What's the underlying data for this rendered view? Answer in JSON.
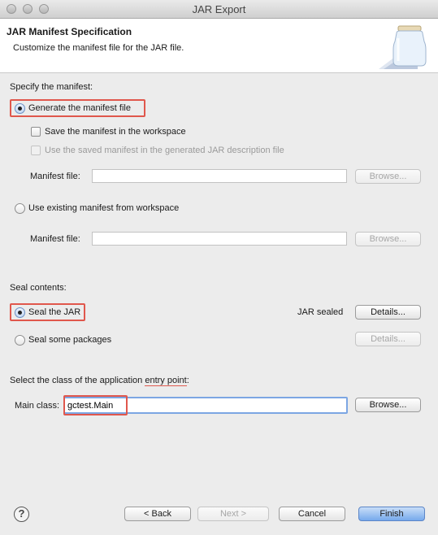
{
  "window": {
    "title": "JAR Export"
  },
  "banner": {
    "title": "JAR Manifest Specification",
    "subtitle": "Customize the manifest file for the JAR file.",
    "icon": "jar-icon"
  },
  "manifest": {
    "section_label": "Specify the manifest:",
    "generate_label": "Generate the manifest file",
    "generate_selected": true,
    "save_in_workspace_label": "Save the manifest in the workspace",
    "save_in_workspace_checked": false,
    "use_saved_label": "Use the saved manifest in the generated JAR description file",
    "use_saved_enabled": false,
    "manifest_file_label_1": "Manifest file:",
    "manifest_file_value_1": "",
    "browse_label_1": "Browse...",
    "use_existing_label": "Use existing manifest from workspace",
    "use_existing_selected": false,
    "manifest_file_label_2": "Manifest file:",
    "manifest_file_value_2": "",
    "browse_label_2": "Browse..."
  },
  "seal": {
    "section_label": "Seal contents:",
    "seal_jar_label": "Seal the JAR",
    "seal_jar_selected": true,
    "status": "JAR sealed",
    "details_label_1": "Details...",
    "seal_packages_label": "Seal some packages",
    "seal_packages_selected": false,
    "details_label_2": "Details..."
  },
  "entry": {
    "section_label_prefix": "Select the class of the application ",
    "section_label_link": "entry point",
    "section_label_suffix": ":",
    "main_class_label": "Main class:",
    "main_class_value": "gctest.Main",
    "browse_label": "Browse..."
  },
  "footer": {
    "help_glyph": "?",
    "back_label": "< Back",
    "next_label": "Next >",
    "cancel_label": "Cancel",
    "finish_label": "Finish"
  },
  "colors": {
    "highlight": "#e0574c",
    "primary_button": "#76a9ec"
  }
}
